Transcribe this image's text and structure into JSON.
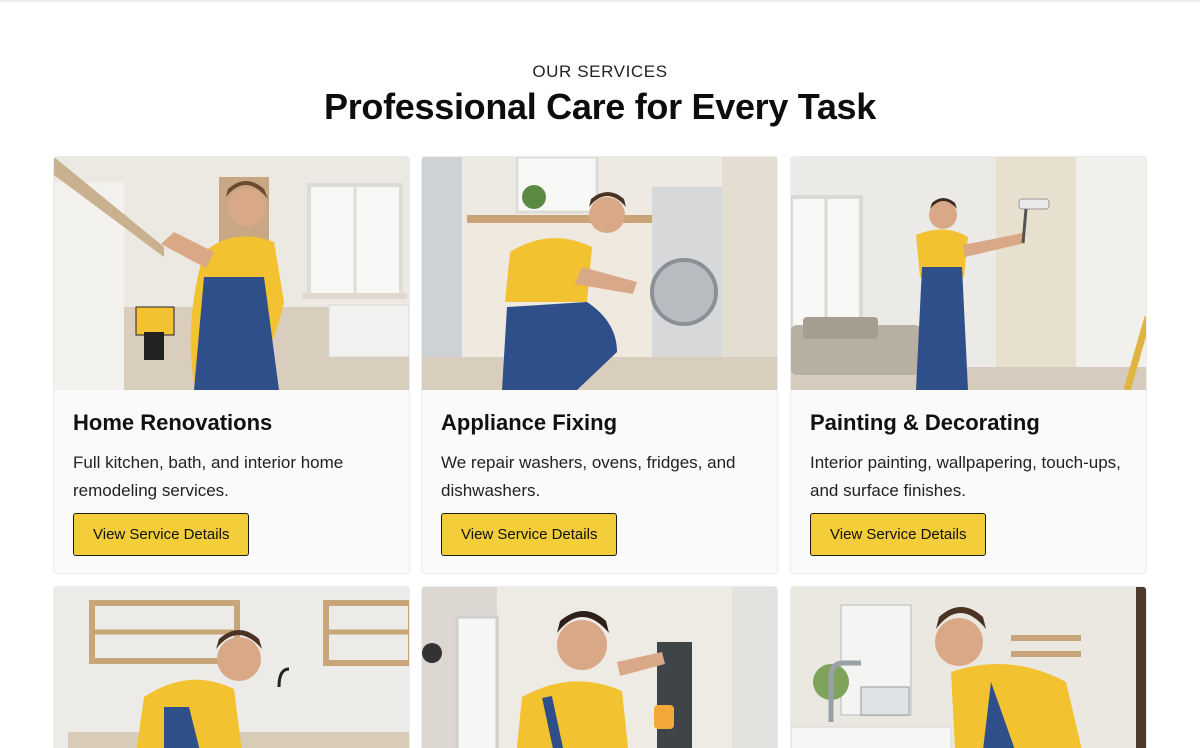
{
  "services": {
    "eyebrow": "OUR SERVICES",
    "title": "Professional Care for Every Task"
  },
  "cards": [
    {
      "title": "Home Renovations",
      "description": "Full kitchen, bath, and interior home remodeling services.",
      "button": "View Service Details",
      "image": "worker-drilling-cabinet-photo"
    },
    {
      "title": "Appliance Fixing",
      "description": "We repair washers, ovens, fridges, and dishwashers.",
      "button": "View Service Details",
      "image": "worker-repairing-washer-photo"
    },
    {
      "title": "Painting & Decorating",
      "description": "Interior painting, wallpapering, touch-ups, and surface finishes.",
      "button": "View Service Details",
      "image": "worker-painting-wall-photo"
    },
    {
      "image": "worker-kitchen-shelving-photo"
    },
    {
      "image": "worker-electrical-panel-photo"
    },
    {
      "image": "worker-plumbing-sink-photo"
    }
  ],
  "colors": {
    "accent": "#f3cd3a",
    "uniform_yellow": "#f2c230",
    "uniform_blue": "#2f4f8a",
    "card_bg": "#fafafa"
  }
}
